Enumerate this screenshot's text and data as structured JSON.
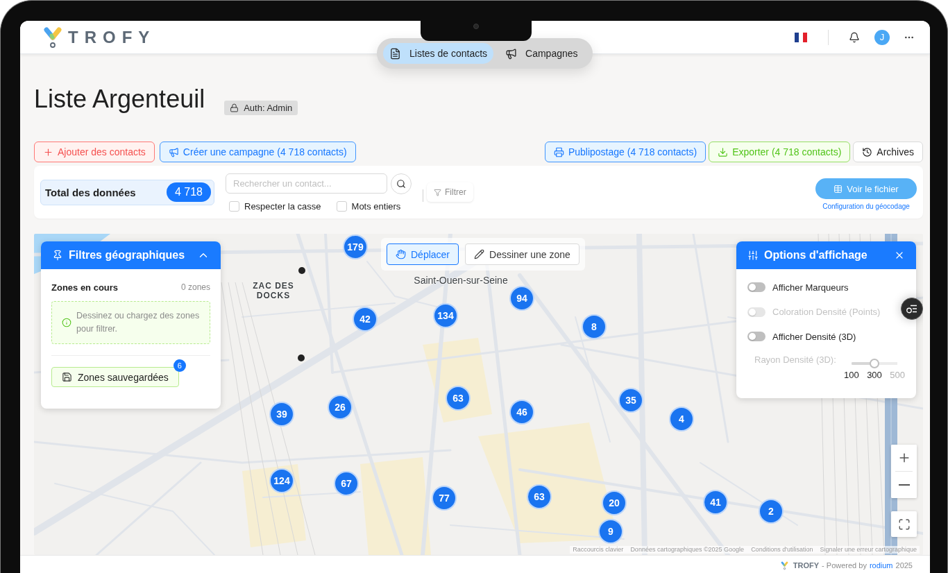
{
  "header": {
    "logo": "TROFY",
    "avatar": "J"
  },
  "nav_tabs": [
    {
      "label": "Listes de contacts",
      "selected": true
    },
    {
      "label": "Campagnes",
      "selected": false
    }
  ],
  "page": {
    "title": "Liste Argenteuil",
    "badge": "Auth: Admin"
  },
  "actions_left": [
    {
      "label": "Ajouter des contacts",
      "kind": "danger"
    },
    {
      "label": "Créer une campagne (4 718 contacts)",
      "kind": "primary"
    }
  ],
  "actions_right": [
    {
      "label": "Publipostage (4 718 contacts)",
      "kind": "primary"
    },
    {
      "label": "Exporter (4 718 contacts)",
      "kind": "success"
    },
    {
      "label": "Archives",
      "kind": "default"
    }
  ],
  "summary": {
    "label": "Total des données",
    "count": "4 718"
  },
  "search": {
    "placeholder": "Rechercher un contact...",
    "options": [
      {
        "label": "Respecter la casse",
        "checked": false
      },
      {
        "label": "Mots entiers",
        "checked": false
      }
    ],
    "filter_button": "Filtrer"
  },
  "file": {
    "button": "Voir le fichier",
    "link": "Configuration du géocodage"
  },
  "geo_filters": {
    "title": "Filtres géographiques",
    "expanded": true,
    "section": "Zones en cours",
    "zone_count": "0 zones",
    "hint": "Dessinez ou chargez des zones pour filtrer.",
    "saved_button": "Zones sauvegardées",
    "saved_count": "6"
  },
  "map": {
    "tools": [
      {
        "label": "Déplacer",
        "selected": true
      },
      {
        "label": "Dessiner une zone",
        "selected": false
      }
    ],
    "place_labels": [
      "Saint-Ouen-sur-Seine",
      "ZAC DES DOCKS"
    ],
    "clusters": [
      {
        "count": "179"
      },
      {
        "count": "42"
      },
      {
        "count": "134"
      },
      {
        "count": "94"
      },
      {
        "count": "8"
      },
      {
        "count": "39"
      },
      {
        "count": "26"
      },
      {
        "count": "63"
      },
      {
        "count": "46"
      },
      {
        "count": "35"
      },
      {
        "count": "4"
      },
      {
        "count": "124"
      },
      {
        "count": "67"
      },
      {
        "count": "77"
      },
      {
        "count": "63"
      },
      {
        "count": "20"
      },
      {
        "count": "41"
      },
      {
        "count": "2"
      },
      {
        "count": "9"
      }
    ],
    "attribution": [
      "Raccourcis clavier",
      "Données cartographiques ©2025 Google",
      "Conditions d'utilisation",
      "Signaler une erreur cartographique"
    ]
  },
  "display_options": {
    "title": "Options d'affichage",
    "toggles": [
      {
        "label": "Afficher Marqueurs",
        "on": false,
        "disabled": false
      },
      {
        "label": "Coloration Densité (Points)",
        "on": false,
        "disabled": true
      },
      {
        "label": "Afficher Densité (3D)",
        "on": false,
        "disabled": false
      }
    ],
    "radius": {
      "label": "Rayon Densité (3D):",
      "disabled": true,
      "level": 0.5,
      "marks": [
        "100",
        "300",
        "500"
      ]
    }
  },
  "footer": {
    "brand": "TROFY",
    "text": "- Powered by",
    "link": "rodium",
    "year": "2025"
  }
}
